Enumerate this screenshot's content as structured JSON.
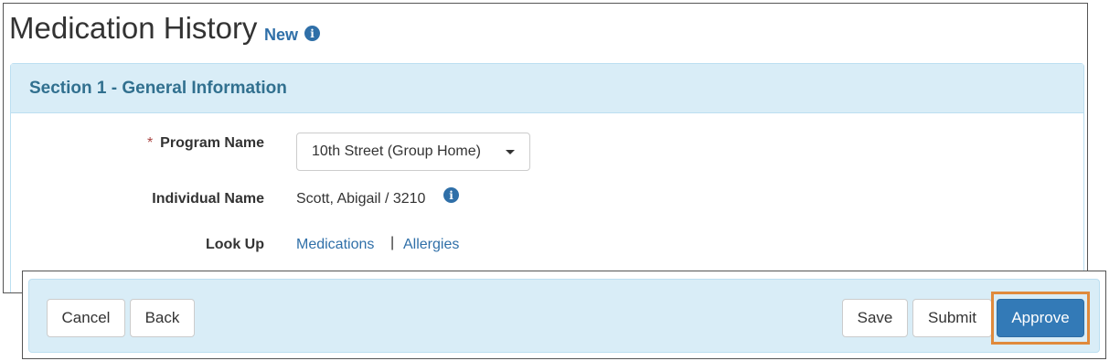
{
  "header": {
    "title": "Medication History",
    "status": "New",
    "status_info_icon": "info-circle-icon"
  },
  "section1": {
    "heading": "Section 1 - General Information",
    "fields": {
      "program_name": {
        "required_marker": "*",
        "label": "Program Name",
        "selected_value": "10th Street (Group Home)"
      },
      "individual_name": {
        "label": "Individual Name",
        "value": "Scott, Abigail / 3210",
        "info_icon": "info-circle-icon"
      },
      "look_up": {
        "label": "Look Up",
        "links": [
          "Medications",
          "Allergies"
        ],
        "separator": "|"
      }
    }
  },
  "footer": {
    "cancel": "Cancel",
    "back": "Back",
    "save": "Save",
    "submit": "Submit",
    "approve": "Approve",
    "highlight_color": "#e08a3c"
  },
  "colors": {
    "primary": "#337ab7",
    "link": "#2f6fa8",
    "panel_heading_bg": "#d9edf7",
    "panel_heading_text": "#31708f",
    "required": "#a94442"
  }
}
